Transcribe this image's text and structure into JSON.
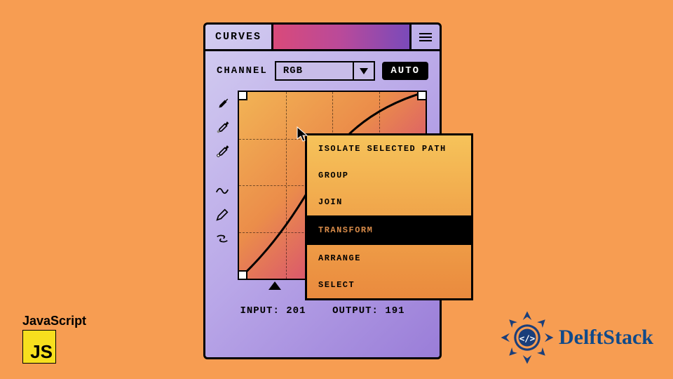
{
  "panel": {
    "title": "CURVES",
    "channel_label": "CHANNEL",
    "channel_value": "RGB",
    "auto_label": "AUTO"
  },
  "io": {
    "input_label": "INPUT:",
    "input_value": "201",
    "output_label": "OUTPUT:",
    "output_value": "191"
  },
  "context_menu": {
    "items": [
      {
        "label": "ISOLATE SELECTED PATH",
        "selected": false
      },
      {
        "label": "GROUP",
        "selected": false
      },
      {
        "label": "JOIN",
        "selected": false
      },
      {
        "label": "TRANSFORM",
        "selected": true
      },
      {
        "label": "ARRANGE",
        "selected": false
      },
      {
        "label": "SELECT",
        "selected": false
      }
    ]
  },
  "badges": {
    "js_label": "JavaScript",
    "js_logo": "JS",
    "brand": "DelftStack"
  },
  "tools": [
    "eyedropper-black",
    "eyedropper-gray",
    "eyedropper-white",
    "curve-smooth",
    "pencil",
    "swap-arrows"
  ]
}
